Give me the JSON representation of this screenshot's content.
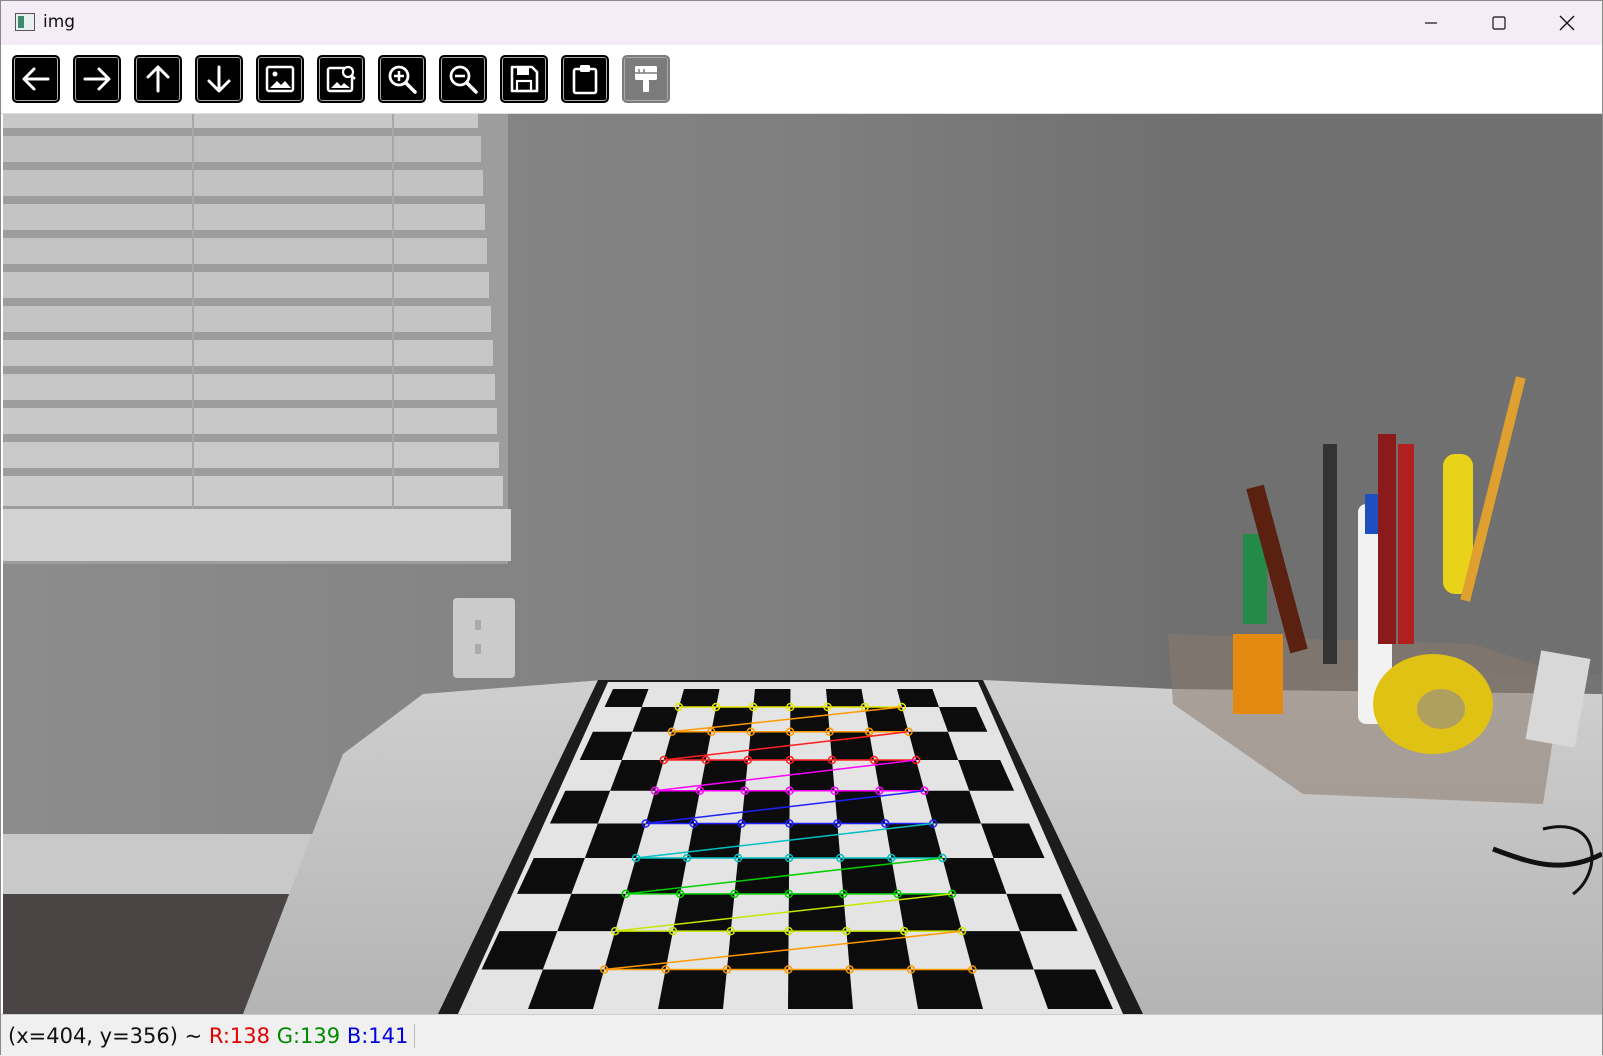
{
  "window": {
    "title": "img"
  },
  "toolbar": {
    "buttons": [
      {
        "name": "pan-left-button",
        "icon": "arrow-left-icon"
      },
      {
        "name": "pan-right-button",
        "icon": "arrow-right-icon"
      },
      {
        "name": "pan-up-button",
        "icon": "arrow-up-icon"
      },
      {
        "name": "pan-down-button",
        "icon": "arrow-down-icon"
      },
      {
        "name": "zoom-reset-button",
        "icon": "image-icon"
      },
      {
        "name": "zoom-fit-button",
        "icon": "image-zoom-icon"
      },
      {
        "name": "zoom-in-button",
        "icon": "zoom-in-icon"
      },
      {
        "name": "zoom-out-button",
        "icon": "zoom-out-icon"
      },
      {
        "name": "save-button",
        "icon": "save-icon"
      },
      {
        "name": "copy-clipboard-button",
        "icon": "clipboard-icon"
      },
      {
        "name": "properties-button",
        "icon": "brush-icon",
        "disabled": true
      }
    ]
  },
  "image": {
    "description_tag": "camera frame with chessboard calibration pattern and detected corners",
    "grid_rows": 9,
    "grid_cols": 7,
    "row_colors": [
      "#e6e600",
      "#ff9900",
      "#ff2020",
      "#ff00ff",
      "#2020ff",
      "#00c0c0",
      "#00d000",
      "#c8e600",
      "#ff9900",
      "#ff2020"
    ]
  },
  "status": {
    "coords": "(x=404, y=356) ~ ",
    "r": "R:138",
    "g": "G:139",
    "b": "B:141"
  }
}
